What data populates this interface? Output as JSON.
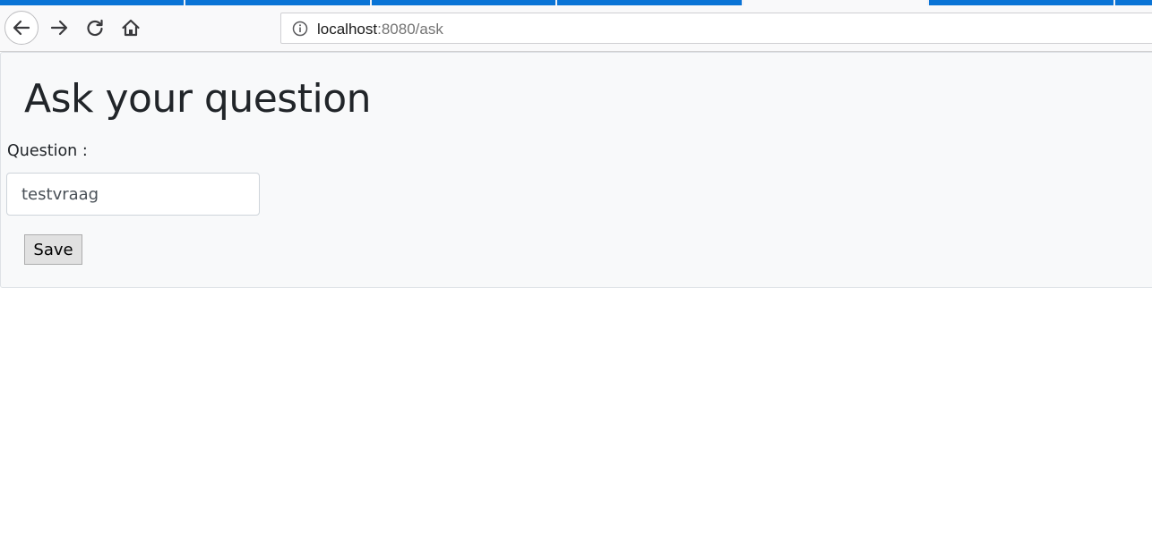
{
  "browser": {
    "url_host": "localhost",
    "url_rest": ":8080/ask"
  },
  "page": {
    "title": "Ask your question",
    "question_label": "Question :",
    "question_value": "testvraag",
    "save_label": "Save"
  },
  "colors": {
    "tab_accent": "#0a74d6",
    "panel_bg": "#f8f9fa",
    "text": "#212529"
  }
}
